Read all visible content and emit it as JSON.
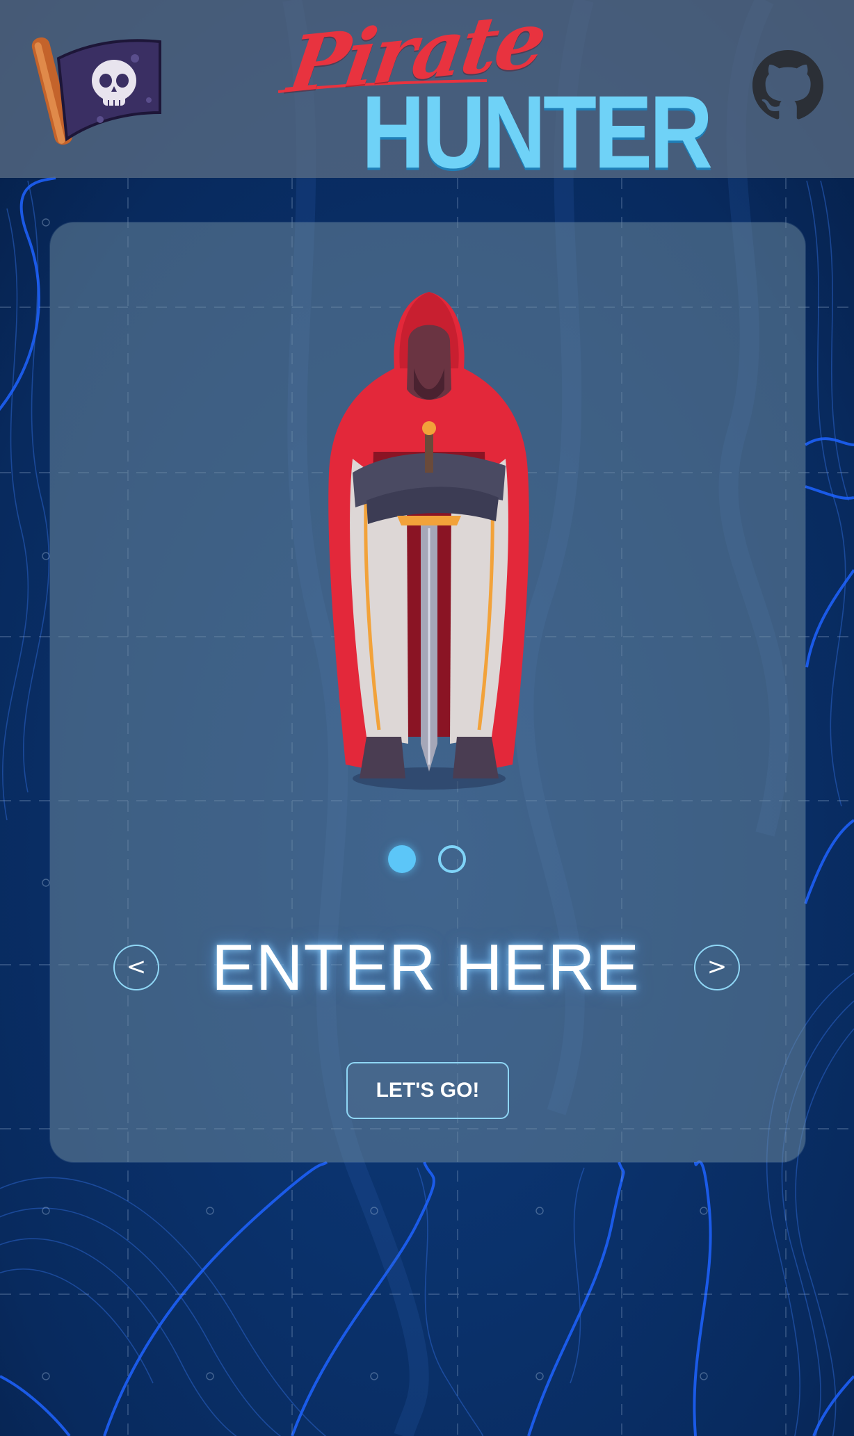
{
  "header": {
    "brand_line1": "Pirate",
    "brand_line2": "HUNTER",
    "colors": {
      "brand_red": "#e8333f",
      "brand_cyan": "#6fd2f7",
      "header_bg": "#586c84"
    },
    "icons": [
      "pirate-flag-icon",
      "github-icon"
    ]
  },
  "card": {
    "carousel": {
      "slide_count": 2,
      "active_index": 0,
      "character": "red-hooded-knight"
    },
    "title": "ENTER HERE",
    "prev_label": "<",
    "next_label": ">",
    "go_label": "LET'S GO!",
    "colors": {
      "accent": "#5cc6f8",
      "text": "#ffffff"
    }
  }
}
